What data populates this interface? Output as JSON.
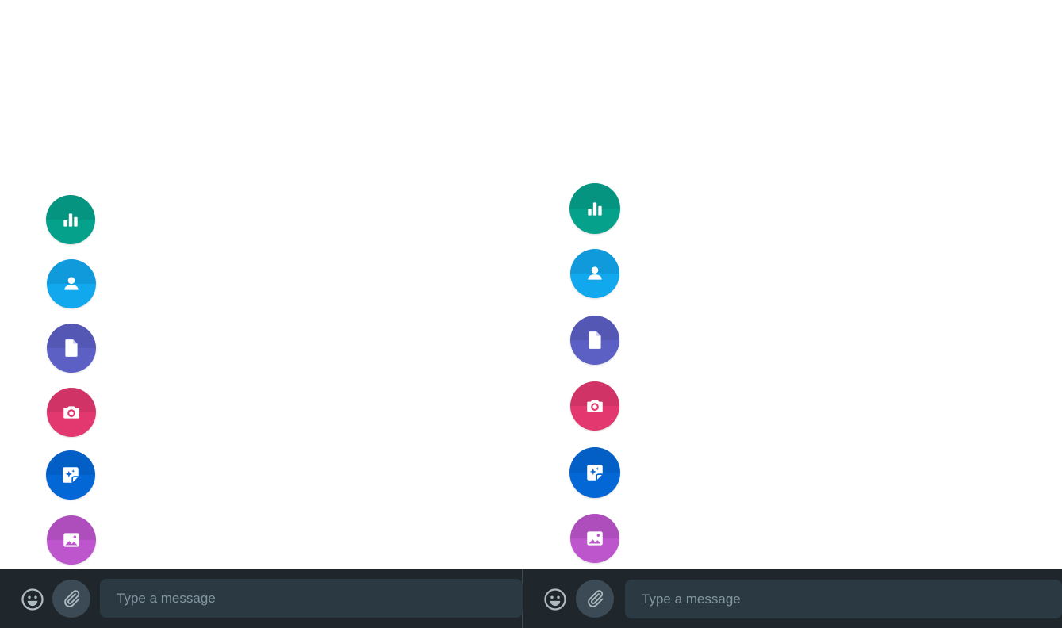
{
  "colors": {
    "poll": "#00a884",
    "contact": "#0ea5e9",
    "document": "#5f66cd",
    "camera": "#e93a75",
    "sticker": "#0063cb",
    "photos": "#bf59cf",
    "composer_bg": "#1f272c",
    "input_bg": "#2a3942"
  },
  "attach_menu": {
    "items": [
      {
        "id": "poll",
        "icon": "poll-icon"
      },
      {
        "id": "contact",
        "icon": "contact-icon"
      },
      {
        "id": "document",
        "icon": "document-icon"
      },
      {
        "id": "camera",
        "icon": "camera-icon"
      },
      {
        "id": "sticker",
        "icon": "new-sticker-icon"
      },
      {
        "id": "photos",
        "icon": "photos-videos-icon"
      }
    ]
  },
  "composer": {
    "placeholder": "Type a message",
    "emoji_icon": "emoji-icon",
    "attach_icon": "paperclip-icon"
  }
}
